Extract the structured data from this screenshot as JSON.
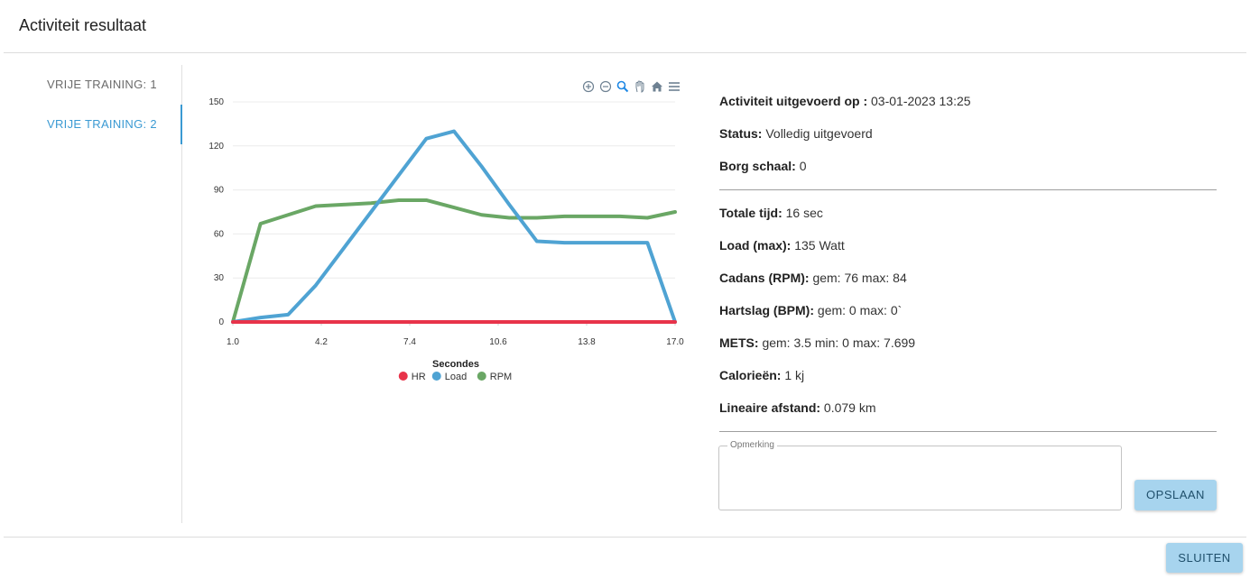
{
  "dialog": {
    "title": "Activiteit resultaat"
  },
  "sidebar": {
    "items": [
      {
        "label": "VRIJE TRAINING: 1",
        "active": false
      },
      {
        "label": "VRIJE TRAINING: 2",
        "active": true
      }
    ]
  },
  "toolbar": {
    "icons": [
      "zoom-in-icon",
      "zoom-out-icon",
      "selection-zoom-icon",
      "pan-hand-icon",
      "home-reset-icon",
      "menu-icon"
    ]
  },
  "chart_data": {
    "type": "line",
    "xlabel": "Secondes",
    "ylabel": "",
    "xlim": [
      1.0,
      17.0
    ],
    "ylim": [
      0,
      150
    ],
    "xticks": [
      "1.0",
      "4.2",
      "7.4",
      "10.6",
      "13.8",
      "17.0"
    ],
    "yticks": [
      "0",
      "30",
      "60",
      "90",
      "120",
      "150"
    ],
    "grid": true,
    "legend_position": "bottom-center",
    "x": [
      1,
      2,
      3,
      4,
      5,
      6,
      7,
      8,
      9,
      10,
      11,
      12,
      13,
      14,
      15,
      16,
      17
    ],
    "series": [
      {
        "name": "HR",
        "color": "#e8334a",
        "values": [
          0,
          0,
          0,
          0,
          0,
          0,
          0,
          0,
          0,
          0,
          0,
          0,
          0,
          0,
          0,
          0,
          0
        ]
      },
      {
        "name": "Load",
        "color": "#4fa3d3",
        "values": [
          0,
          3,
          5,
          25,
          50,
          75,
          100,
          125,
          130,
          106,
          80,
          55,
          54,
          54,
          54,
          54,
          0
        ]
      },
      {
        "name": "RPM",
        "color": "#6aa765",
        "values": [
          0,
          67,
          73,
          79,
          80,
          81,
          83,
          83,
          78,
          73,
          71,
          71,
          72,
          72,
          72,
          71,
          75
        ]
      }
    ]
  },
  "info": {
    "performed_label": "Activiteit uitgevoerd op :",
    "performed_value": " 03-01-2023 13:25",
    "status_label": "Status:",
    "status_value": " Volledig uitgevoerd",
    "borg_label": "Borg schaal:",
    "borg_value": " 0",
    "total_time_label": "Totale tijd:",
    "total_time_value": " 16 sec",
    "load_label": "Load (max):",
    "load_value": " 135 Watt",
    "cadence_label": "Cadans (RPM):",
    "cadence_value": " gem: 76 max: 84",
    "heartrate_label": "Hartslag (BPM):",
    "heartrate_value": " gem: 0 max: 0`",
    "mets_label": "METS:",
    "mets_value": " gem: 3.5 min: 0 max: 7.699",
    "calories_label": "Calorieën:",
    "calories_value": " 1 kj",
    "distance_label": "Lineaire afstand:",
    "distance_value": " 0.079 km"
  },
  "note": {
    "label": "Opmerking",
    "value": ""
  },
  "buttons": {
    "save": "OPSLAAN",
    "close": "SLUITEN"
  }
}
